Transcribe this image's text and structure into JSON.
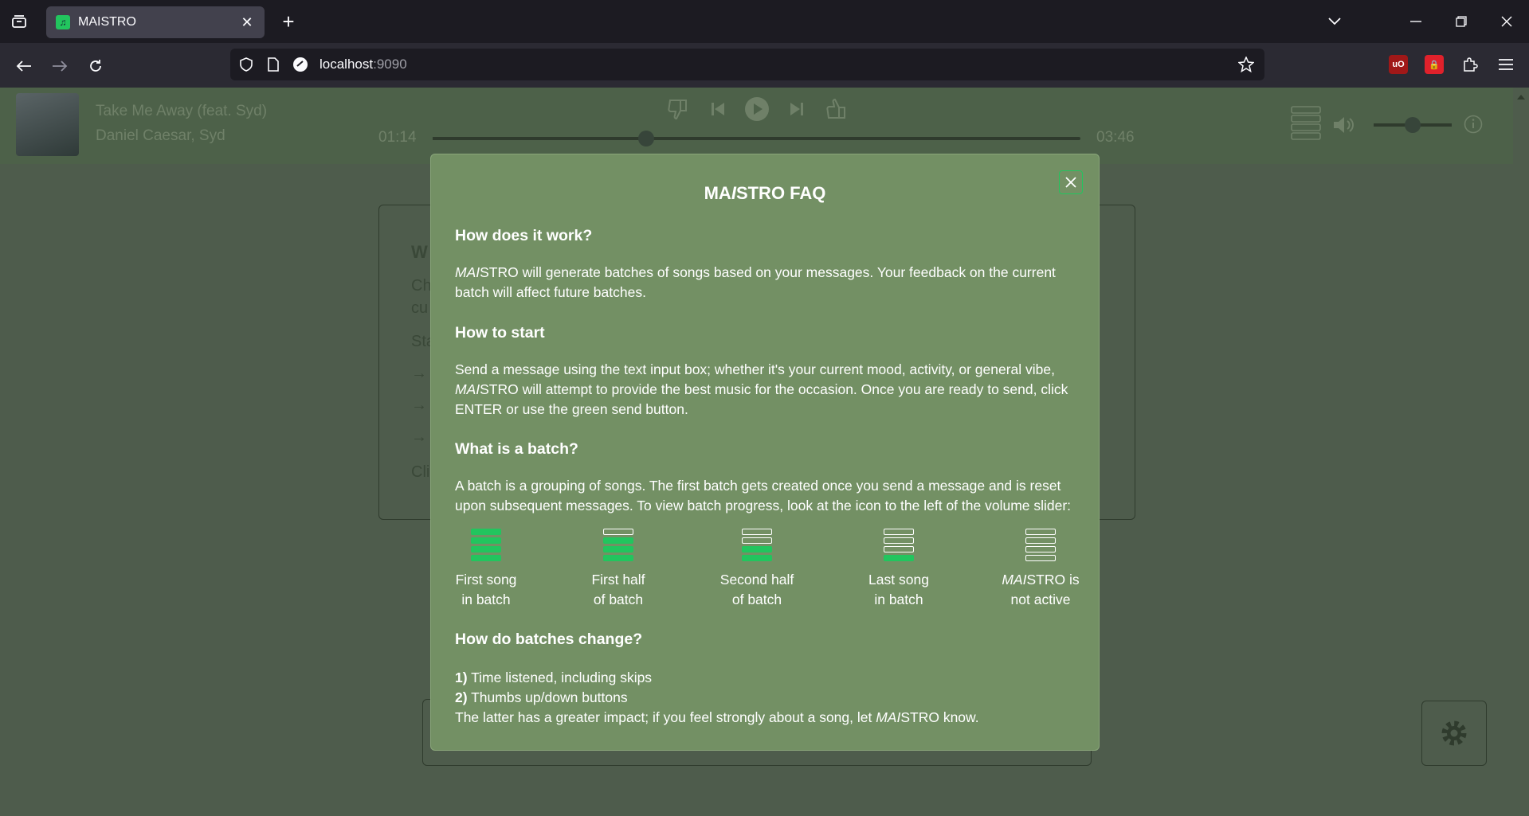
{
  "browser": {
    "tab_title": "MAISTRO",
    "url_host": "localhost",
    "url_port": ":9090"
  },
  "player": {
    "song_title": "Take Me Away (feat. Syd)",
    "artist": "Daniel Caesar, Syd",
    "elapsed": "01:14",
    "duration": "03:46",
    "progress_fraction": 0.33,
    "volume_fraction": 0.5
  },
  "modal": {
    "title_prefix": "MA",
    "title_italic": "I",
    "title_suffix": "STRO FAQ",
    "sections": [
      {
        "heading": "How does it work?",
        "body_italic": "MAI",
        "body": "STRO will generate batches of songs based on your messages. Your feedback on the current batch will affect future batches."
      },
      {
        "heading": "How to start",
        "body_pre": "Send a message using the text input box; whether it's your current mood, activity, or general vibe, ",
        "body_italic": "MAI",
        "body": "STRO will attempt to provide the best music for the occasion. Once you are ready to send, click ENTER or use the green send button."
      },
      {
        "heading": "What is a batch?",
        "body": "A batch is a grouping of songs. The first batch gets created once you send a message and is reset upon subsequent messages. To view batch progress, look at the icon to the left of the volume slider:"
      },
      {
        "heading": "How do batches change?",
        "item1_num": "1)",
        "item1": " Time listened, including skips",
        "item2_num": "2)",
        "item2": " Thumbs up/down buttons",
        "footer_pre": "The latter has a greater impact; if you feel strongly about a song, let ",
        "footer_italic": "MAI",
        "footer_post": "STRO know."
      }
    ],
    "batch_states": [
      {
        "line1": "First song",
        "line2": "in batch",
        "filled": 4
      },
      {
        "line1": "First half",
        "line2": "of batch",
        "filled": 3
      },
      {
        "line1": "Second half",
        "line2": "of batch",
        "filled": 2
      },
      {
        "line1": "Last song",
        "line2": "in batch",
        "filled": 1
      },
      {
        "line1_italic": "MAI",
        "line1": "STRO is",
        "line2": "not active",
        "filled": 0
      }
    ]
  },
  "background": {
    "card_fragments": [
      "W",
      "Ch",
      "cu",
      "Sta",
      "→",
      "→",
      "→",
      "Cli"
    ]
  },
  "colors": {
    "accent": "#22c55e",
    "modal_bg": "#739064",
    "overlay": "#4e5c4c"
  }
}
